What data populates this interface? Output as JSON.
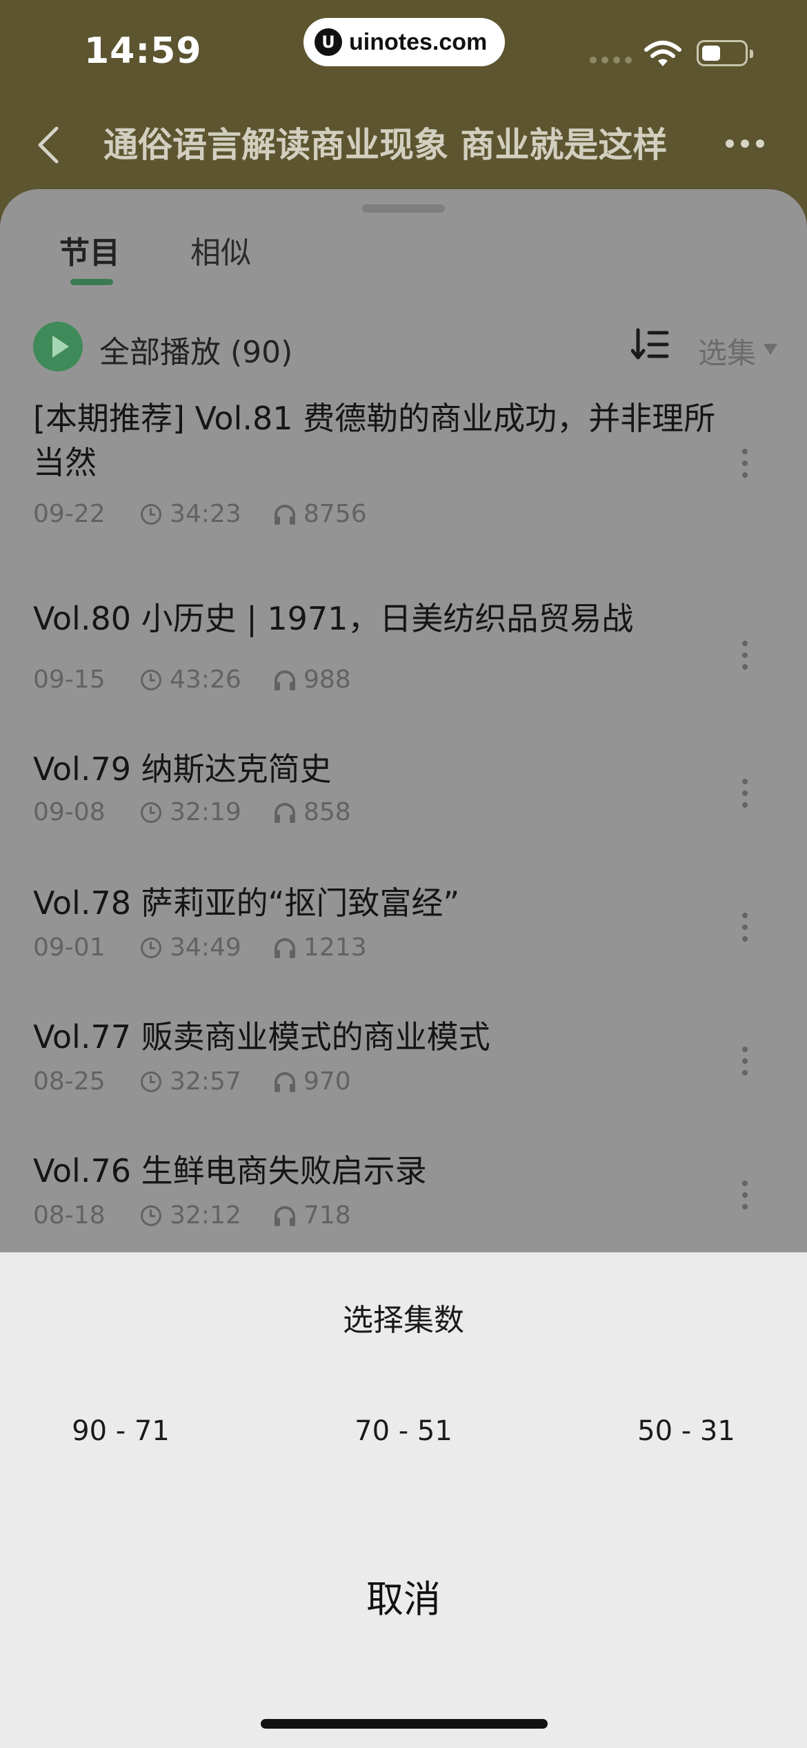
{
  "status_bar": {
    "time": "14:59",
    "watermark": "uinotes.com",
    "watermark_logo": "U"
  },
  "nav": {
    "title": "通俗语言解读商业现象  商业就是这样"
  },
  "tabs": [
    {
      "label": "节目",
      "active": true
    },
    {
      "label": "相似",
      "active": false
    }
  ],
  "play_all": {
    "label": "全部播放 (90)"
  },
  "select_label": "选集",
  "episodes": [
    {
      "title": "[本期推荐] Vol.81 费德勒的商业成功，并非理所当然",
      "date": "09-22",
      "duration": "34:23",
      "plays": "8756"
    },
    {
      "title": "Vol.80 小历史 | 1971，日美纺织品贸易战",
      "date": "09-15",
      "duration": "43:26",
      "plays": "988"
    },
    {
      "title": "Vol.79 纳斯达克简史",
      "date": "09-08",
      "duration": "32:19",
      "plays": "858"
    },
    {
      "title": "Vol.78 萨莉亚的“抠门致富经”",
      "date": "09-01",
      "duration": "34:49",
      "plays": "1213"
    },
    {
      "title": "Vol.77 贩卖商业模式的商业模式",
      "date": "08-25",
      "duration": "32:57",
      "plays": "970"
    },
    {
      "title": "Vol.76 生鲜电商失败启示录",
      "date": "08-18",
      "duration": "32:12",
      "plays": "718"
    }
  ],
  "action_sheet": {
    "title": "选择集数",
    "ranges": [
      "90 - 71",
      "70 - 51",
      "50 - 31"
    ],
    "cancel": "取消"
  },
  "colors": {
    "header_bg": "#5c5530",
    "accent_green": "#3f8a59",
    "dimmed_sheet": "#949494",
    "action_sheet_bg": "#ebebeb"
  }
}
